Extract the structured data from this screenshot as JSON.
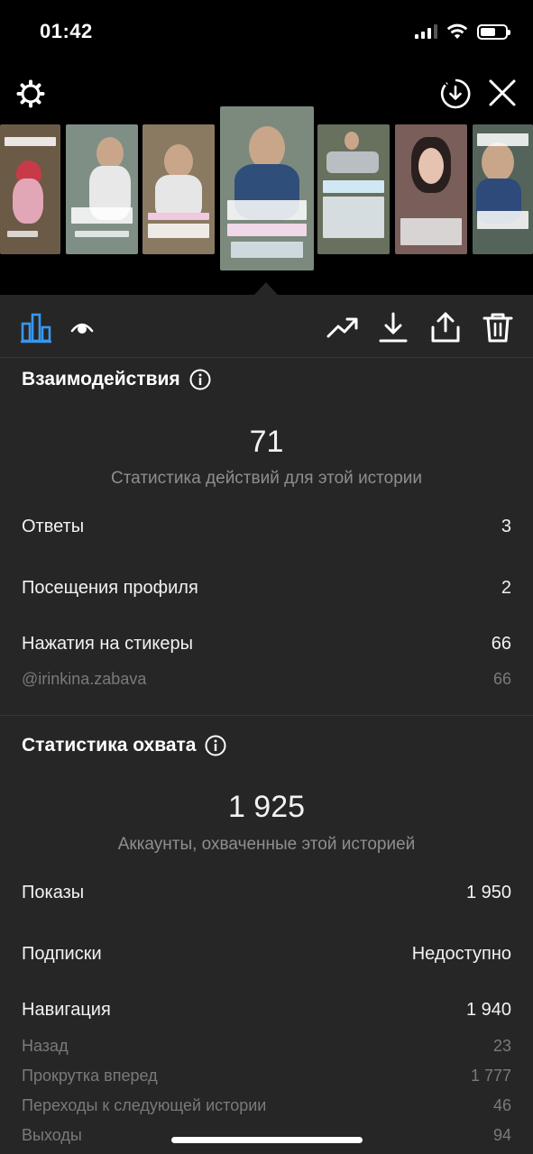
{
  "status": {
    "time": "01:42"
  },
  "toolbar": {
    "settings_icon": "gear-icon",
    "download_icon": "download-circle-icon",
    "close_icon": "close-icon"
  },
  "thumbnails": [
    {
      "name": "story-thumb-1",
      "bg": "#6b5a46",
      "accent": "#c83a4a"
    },
    {
      "name": "story-thumb-2",
      "bg": "#7f8f86",
      "accent": "#3a3a3a"
    },
    {
      "name": "story-thumb-3",
      "bg": "#8a7a62",
      "accent": "#e0e0e0"
    },
    {
      "name": "story-thumb-4",
      "bg": "#7c8a7e",
      "accent": "#2f4f7a"
    },
    {
      "name": "story-thumb-5",
      "bg": "#68705e",
      "accent": "#d6dde0"
    },
    {
      "name": "story-thumb-6",
      "bg": "#7a5e5a",
      "accent": "#2a1f1f"
    },
    {
      "name": "story-thumb-7",
      "bg": "#54645a",
      "accent": "#2d4a7a"
    }
  ],
  "tabs": {
    "stats_icon": "bar-chart-icon",
    "viewers_icon": "eye-icon",
    "promote_icon": "trending-up-icon",
    "save_icon": "download-icon",
    "share_icon": "share-icon",
    "delete_icon": "trash-icon",
    "active_color": "#3897f0"
  },
  "interactions": {
    "title": "Взаимодействия",
    "total": "71",
    "caption": "Статистика действий для этой истории",
    "rows": [
      {
        "label": "Ответы",
        "value": "3"
      },
      {
        "label": "Посещения профиля",
        "value": "2"
      },
      {
        "label": "Нажатия на стикеры",
        "value": "66"
      }
    ],
    "sticker_sub": {
      "label": "@irinkina.zabava",
      "value": "66"
    }
  },
  "reach": {
    "title": "Статистика охвата",
    "total": "1 925",
    "caption": "Аккаунты, охваченные этой историей",
    "rows": [
      {
        "label": "Показы",
        "value": "1 950"
      },
      {
        "label": "Подписки",
        "value": "Недоступно"
      },
      {
        "label": "Навигация",
        "value": "1 940"
      }
    ],
    "navigation_sub": [
      {
        "label": "Назад",
        "value": "23"
      },
      {
        "label": "Прокрутка вперед",
        "value": "1 777"
      },
      {
        "label": "Переходы к следующей истории",
        "value": "46"
      },
      {
        "label": "Выходы",
        "value": "94"
      }
    ]
  }
}
